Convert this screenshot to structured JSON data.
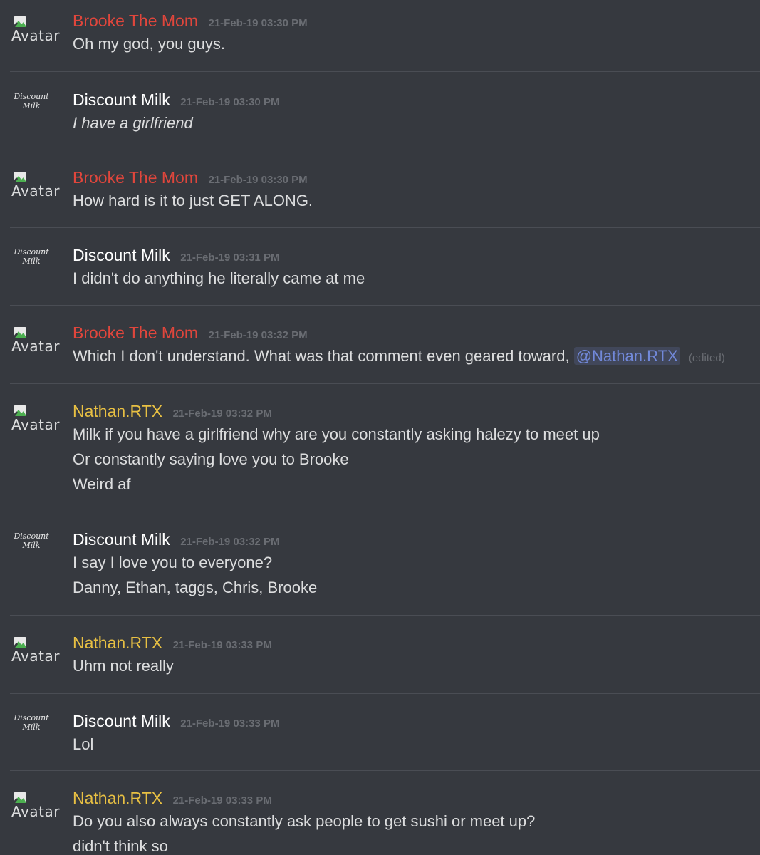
{
  "colors": {
    "background": "#36393f",
    "brooke": "#e0463c",
    "milk": "#ffffff",
    "nathan": "#e8c043",
    "mention": "#7289da",
    "timestamp": "#6a6d73"
  },
  "avatar_alt_text": "Avatar",
  "milk_avatar_text": [
    "Discount",
    "Milk"
  ],
  "messages": [
    {
      "author": "Brooke The Mom",
      "timestamp": "21-Feb-19 03:30 PM",
      "lines": [
        "Oh my god, you guys."
      ]
    },
    {
      "author": "Discount Milk",
      "timestamp": "21-Feb-19 03:30 PM",
      "lines": [
        "I have a girlfriend"
      ]
    },
    {
      "author": "Brooke The Mom",
      "timestamp": "21-Feb-19 03:30 PM",
      "lines": [
        "How hard is it to just GET ALONG."
      ]
    },
    {
      "author": "Discount Milk",
      "timestamp": "21-Feb-19 03:31 PM",
      "lines": [
        "I didn't do anything he literally came at me"
      ]
    },
    {
      "author": "Brooke The Mom",
      "timestamp": "21-Feb-19 03:32 PM",
      "lines": [
        "Which I don't understand. What was that comment even geared toward,"
      ],
      "mention": "@Nathan.RTX",
      "edited": "(edited)"
    },
    {
      "author": "Nathan.RTX",
      "timestamp": "21-Feb-19 03:32 PM",
      "lines": [
        "Milk if you have a girlfriend why are you constantly asking halezy to meet up",
        "Or constantly saying love you to Brooke",
        "Weird af"
      ]
    },
    {
      "author": "Discount Milk",
      "timestamp": "21-Feb-19 03:32 PM",
      "lines": [
        "I say I love you to everyone?",
        "Danny, Ethan, taggs, Chris, Brooke"
      ]
    },
    {
      "author": "Nathan.RTX",
      "timestamp": "21-Feb-19 03:33 PM",
      "lines": [
        "Uhm not really"
      ]
    },
    {
      "author": "Discount Milk",
      "timestamp": "21-Feb-19 03:33 PM",
      "lines": [
        "Lol"
      ]
    },
    {
      "author": "Nathan.RTX",
      "timestamp": "21-Feb-19 03:33 PM",
      "lines": [
        "Do you also always constantly ask people to get sushi or meet up?",
        "didn't think so"
      ]
    }
  ]
}
